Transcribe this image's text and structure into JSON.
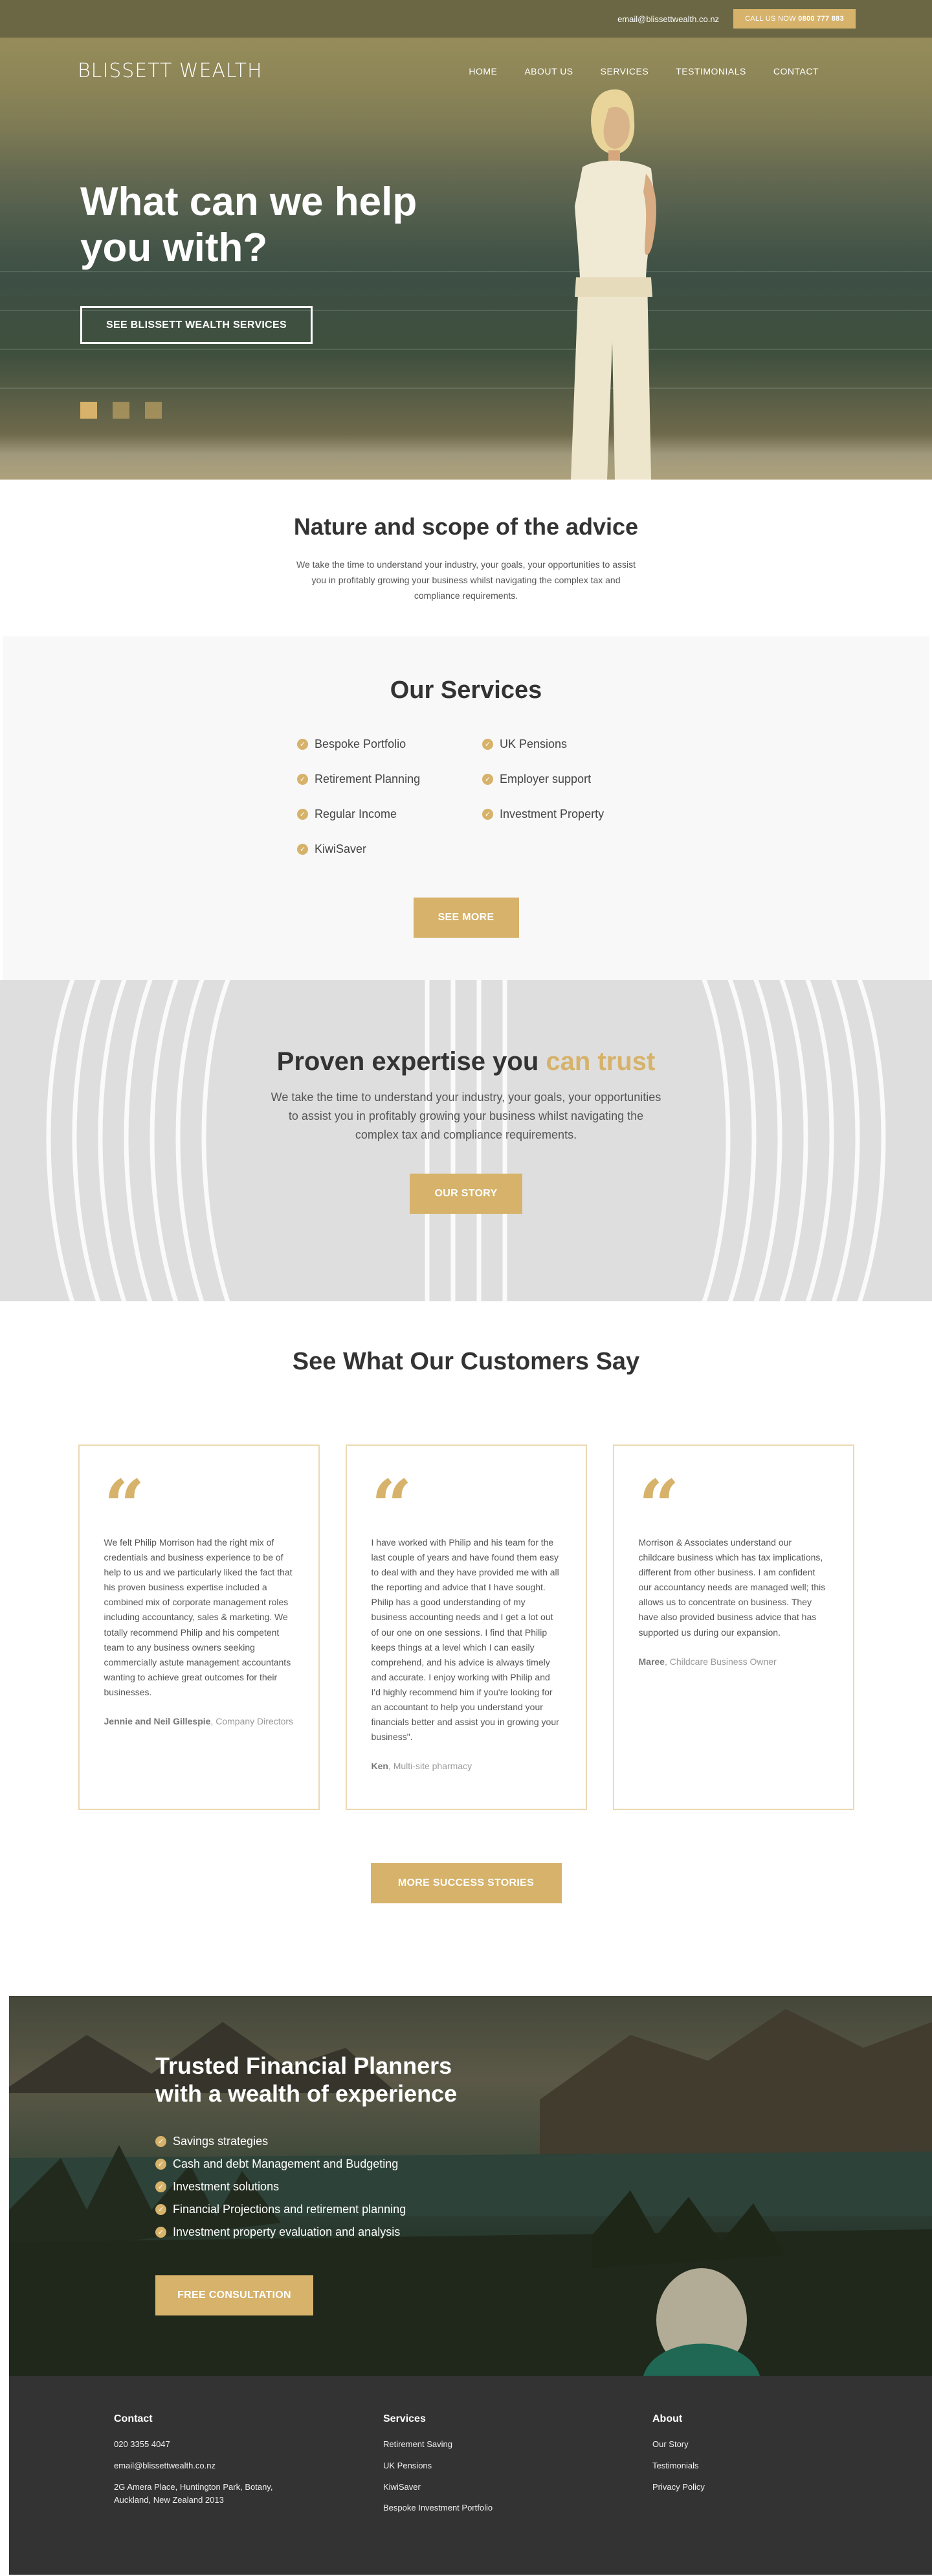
{
  "topbar": {
    "email": "email@blissettwealth.co.nz",
    "call_prefix": "CALL US NOW",
    "call_number": "0800 777 883"
  },
  "nav": {
    "logo": "BLISSETT WEALTH",
    "links": [
      "HOME",
      "ABOUT US",
      "SERVICES",
      "TESTIMONIALS",
      "CONTACT"
    ]
  },
  "hero": {
    "title": "What can we help you with?",
    "button": "SEE BLISSETT WEALTH SERVICES",
    "slides": 3,
    "active_slide": 1
  },
  "nature": {
    "title": "Nature and scope of the advice",
    "text": "We take the time to understand your industry, your goals, your opportunities to assist you in profitably growing your business whilst navigating the complex tax and compliance requirements."
  },
  "services": {
    "title": "Our Services",
    "left": [
      "Bespoke Portfolio",
      "Retirement Planning",
      "Regular Income",
      "KiwiSaver"
    ],
    "right": [
      "UK Pensions",
      "Employer support",
      "Investment Property"
    ],
    "button": "SEE MORE"
  },
  "proven": {
    "title_a": "Proven expertise you ",
    "title_b": "can trust",
    "text": "We take the time to understand your industry, your goals, your opportunities to assist you in profitably growing your business whilst navigating the complex tax and compliance requirements.",
    "button": "OUR STORY"
  },
  "testimonials": {
    "title": "See What Our Customers Say",
    "cards": [
      {
        "text": "We felt Philip Morrison had the right mix of credentials and business experience to be of help to us and we particularly liked the fact that his proven business expertise included a combined mix of corporate management roles including accountancy, sales & marketing. We totally recommend Philip and his competent team to any business owners seeking commercially astute management accountants wanting to achieve great outcomes for their businesses.",
        "name": "Jennie and Neil Gillespie",
        "role": "Company Directors"
      },
      {
        "text": "I have worked with Philip and his team for the last couple of years and have found them easy to deal with and they have provided me with all the reporting and advice that I have sought. Philip has a good understanding of my business accounting needs and I get a lot out of our one on one sessions. I find that Philip keeps things at a level which I can easily comprehend, and his advice is always timely and accurate. I enjoy working with Philip and I'd highly recommend him if you're looking for an accountant to help you understand your financials better and assist you in growing your business\".",
        "name": "Ken",
        "role": "Multi-site pharmacy"
      },
      {
        "text": "Morrison & Associates understand our childcare business which has tax implications, different from other business. I am confident our accountancy needs are managed well; this allows us to concentrate on business. They have also provided business advice that has supported us during our expansion.",
        "name": "Maree",
        "role": "Childcare Business Owner"
      }
    ],
    "quote_mark": "“",
    "button": "MORE SUCCESS STORIES"
  },
  "trusted": {
    "title_line1": "Trusted Financial Planners",
    "title_line2": "with a wealth of experience",
    "items": [
      "Savings strategies",
      "Cash and debt Management and Budgeting",
      "Investment solutions",
      "Financial Projections and retirement planning",
      "Investment property evaluation and analysis"
    ],
    "button": "FREE CONSULTATION"
  },
  "footer": {
    "contact": {
      "title": "Contact",
      "phone": "020 3355 4047",
      "email": "email@blissettwealth.co.nz",
      "address": "2G Amera Place, Huntington Park, Botany, Auckland, New Zealand 2013"
    },
    "services": {
      "title": "Services",
      "links": [
        "Retirement Saving",
        "UK Pensions",
        "KiwiSaver",
        "Bespoke Investment Portfolio"
      ]
    },
    "about": {
      "title": "About",
      "links": [
        "Our Story",
        "Testimonials",
        "Privacy Policy"
      ]
    }
  },
  "colors": {
    "accent": "#d6b26a",
    "topbar": "#6b6744",
    "footer": "#333333"
  }
}
